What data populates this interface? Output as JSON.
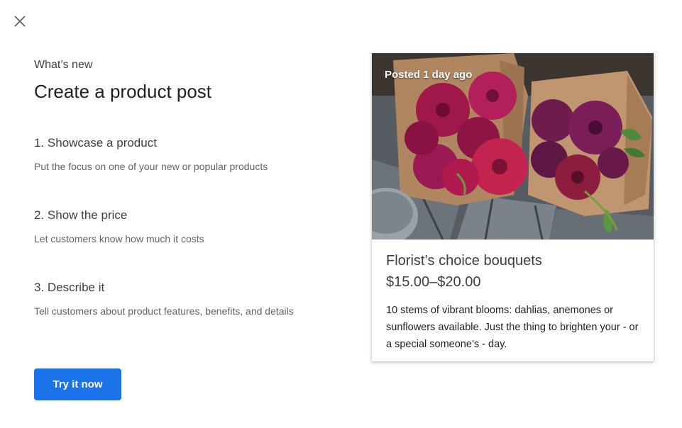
{
  "dialog": {
    "close_icon": "close-icon",
    "eyebrow": "What’s new",
    "title": "Create a product post"
  },
  "steps": [
    {
      "title": "1. Showcase a product",
      "description": "Put the focus on one of your new or popular products"
    },
    {
      "title": "2. Show the price",
      "description": "Let customers know how much it costs"
    },
    {
      "title": "3. Describe it",
      "description": "Tell customers about product features, benefits, and details"
    }
  ],
  "cta": {
    "label": "Try it now",
    "color": "#1a73e8"
  },
  "preview_card": {
    "posted_label": "Posted 1 day ago",
    "image_subject": "bouquets of purple dahlias wrapped in brown paper",
    "product_name": "Florist’s choice bouquets",
    "price": "$15.00–$20.00",
    "description": "10 stems of vibrant blooms: dahlias, anemones or sunflowers available. Just the thing to brighten your - or a special someone’s - day."
  }
}
